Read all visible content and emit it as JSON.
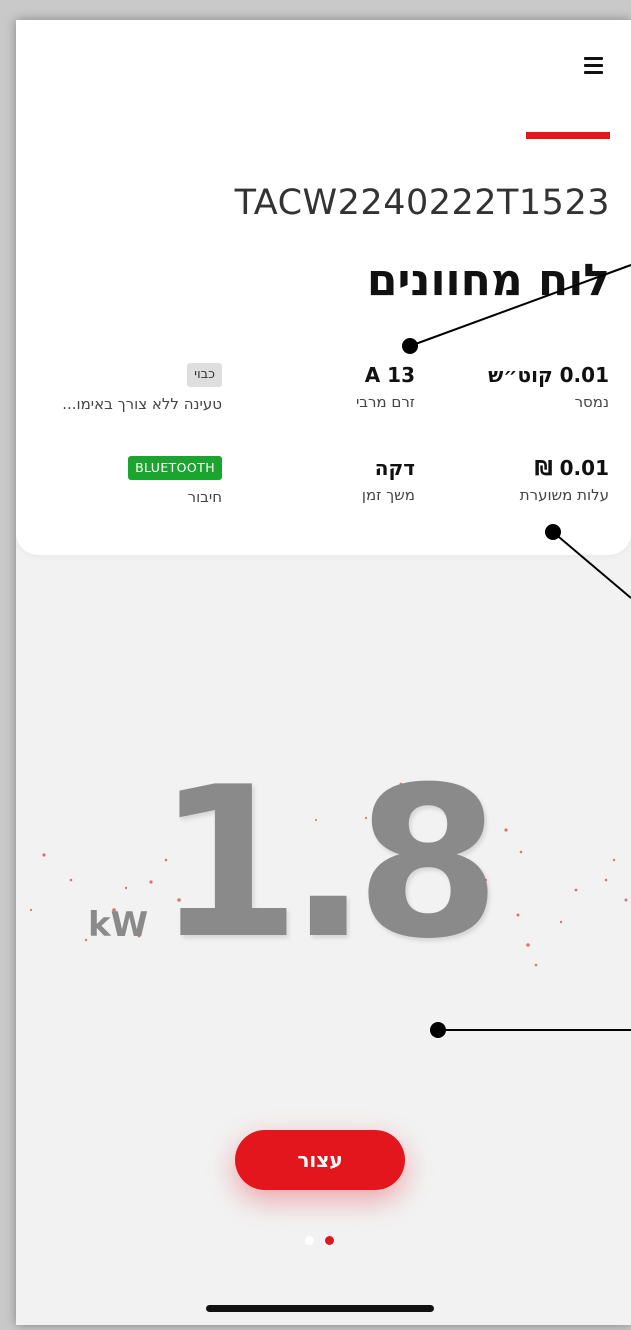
{
  "header": {
    "menu_icon": "hamburger-menu-icon",
    "accent_color": "#e3151d"
  },
  "device": {
    "serial": "TACW2240222T1523"
  },
  "page": {
    "title": "לוח מחוונים"
  },
  "stats": [
    {
      "id": "energy",
      "value": "0.01 קוט״ש",
      "label": "נמסר"
    },
    {
      "id": "current",
      "value": "13 A",
      "label": "זרם מרבי"
    },
    {
      "id": "mode",
      "badge": "כבוי",
      "label": "טעינה ללא צורך באימו..."
    },
    {
      "id": "cost",
      "value": "0.01 ₪",
      "label": "עלות משוערת"
    },
    {
      "id": "duration",
      "value": "דקה",
      "label": "משך זמן"
    },
    {
      "id": "connection",
      "badge": "BLUETOOTH",
      "label": "חיבור",
      "badge_color": "#1aa52e"
    }
  ],
  "power": {
    "value": "1.8",
    "unit": "kW"
  },
  "actions": {
    "stop_label": "עצור"
  },
  "pager": {
    "total": 2,
    "active_index": 1
  }
}
